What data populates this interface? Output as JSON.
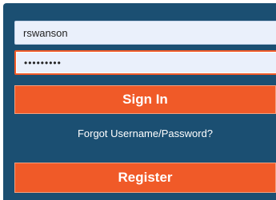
{
  "login": {
    "username_value": "rswanson",
    "password_value": "•••••••••",
    "signin_label": "Sign In",
    "forgot_label": "Forgot Username/Password?",
    "register_label": "Register"
  },
  "colors": {
    "panel_background": "#1b4f72",
    "button_accent": "#f05a28",
    "input_background": "#eaf0fb"
  }
}
